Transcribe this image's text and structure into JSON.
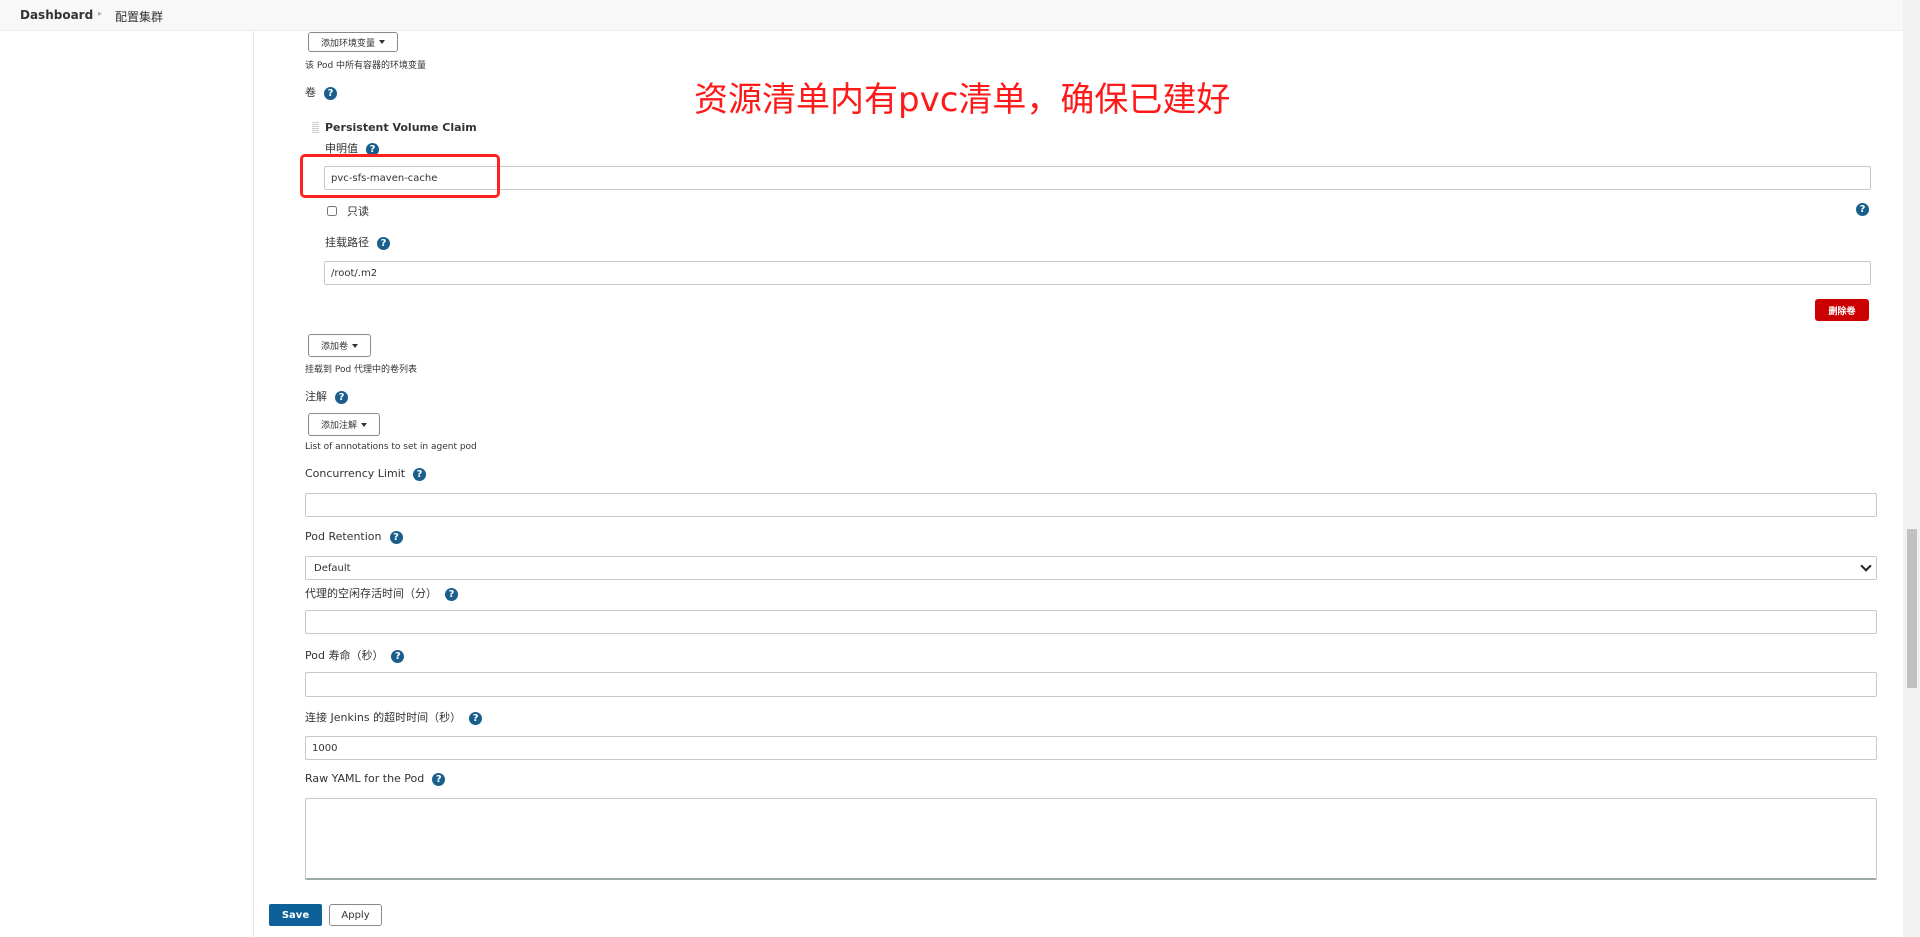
{
  "breadcrumb": {
    "items": [
      "Dashboard",
      "配置集群"
    ]
  },
  "annotation_note": "资源清单内有pvc清单，确保已建好",
  "env": {
    "add_button": "添加环境变量",
    "description": "该 Pod 中所有容器的环境变量"
  },
  "volumes": {
    "label": "卷",
    "pvc": {
      "title": "Persistent Volume Claim",
      "claim_label": "申明值",
      "claim_value": "pvc-sfs-maven-cache",
      "readonly_label": "只读",
      "readonly_checked": false,
      "mount_label": "挂载路径",
      "mount_value": "/root/.m2",
      "delete_button": "删除卷"
    },
    "add_button": "添加卷",
    "description": "挂载到 Pod 代理中的卷列表"
  },
  "annotations": {
    "label": "注解",
    "add_button": "添加注解",
    "description": "List of annotations to set in agent pod"
  },
  "fields": {
    "concurrency_label": "Concurrency Limit",
    "concurrency_value": "",
    "retention_label": "Pod Retention",
    "retention_value": "Default",
    "idle_label": "代理的空闲存活时间（分）",
    "idle_value": "",
    "lifetime_label": "Pod 寿命（秒）",
    "lifetime_value": "",
    "timeout_label": "连接 Jenkins 的超时时间（秒）",
    "timeout_value": "1000",
    "yaml_label": "Raw YAML for the Pod",
    "yaml_value": ""
  },
  "actions": {
    "save": "Save",
    "apply": "Apply"
  },
  "colors": {
    "primary": "#0e6198",
    "danger": "#cc0000",
    "annotation": "#ff1a1a",
    "help": "#1a5e8c"
  }
}
